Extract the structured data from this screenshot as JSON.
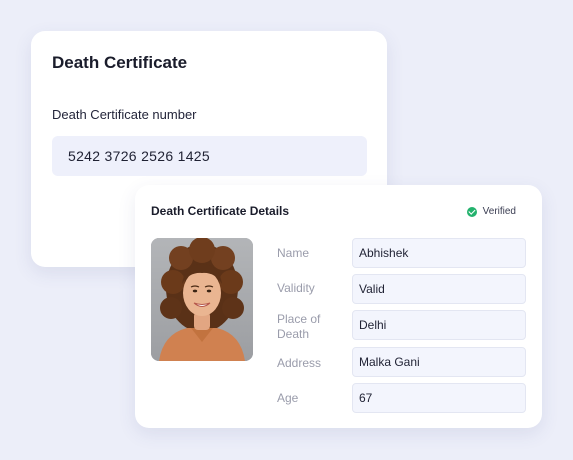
{
  "certificate_card": {
    "title": "Death Certificate",
    "number_label": "Death Certificate  number",
    "number_value": "5242 3726 2526 1425"
  },
  "details_card": {
    "title": "Death Certificate Details",
    "status": "Verified",
    "status_color": "#23b26d",
    "fields": [
      {
        "label": "Name",
        "value": "Abhishek"
      },
      {
        "label": "Validity",
        "value": "Valid"
      },
      {
        "label": "Place of Death",
        "value": "Delhi"
      },
      {
        "label": "Address",
        "value": "Malka Gani"
      },
      {
        "label": "Age",
        "value": "67"
      }
    ]
  }
}
